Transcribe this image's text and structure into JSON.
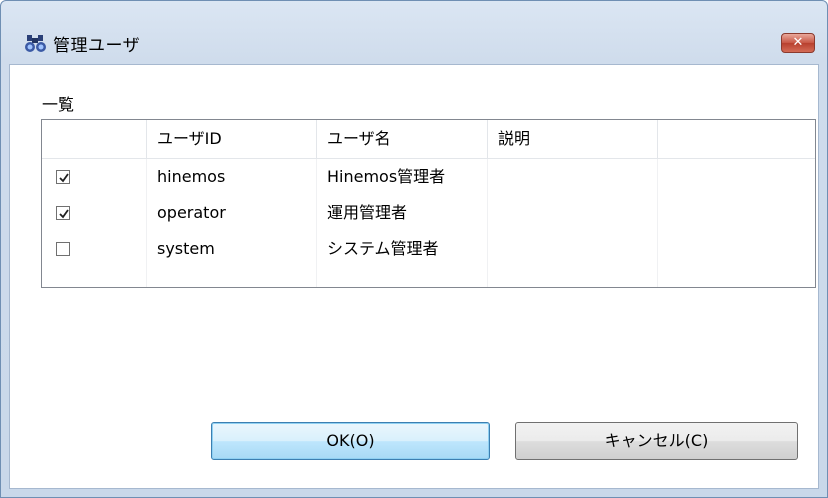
{
  "window": {
    "title": "管理ユーザ",
    "close_label": "✕"
  },
  "section": {
    "label": "一覧"
  },
  "table": {
    "headers": [
      "",
      "ユーザID",
      "ユーザ名",
      "説明",
      ""
    ],
    "rows": [
      {
        "checked": true,
        "user_id": "hinemos",
        "user_name": "Hinemos管理者",
        "description": ""
      },
      {
        "checked": true,
        "user_id": "operator",
        "user_name": "運用管理者",
        "description": ""
      },
      {
        "checked": false,
        "user_id": "system",
        "user_name": "システム管理者",
        "description": ""
      }
    ]
  },
  "buttons": {
    "ok_label": "OK(O)",
    "cancel_label": "キャンセル(C)"
  }
}
